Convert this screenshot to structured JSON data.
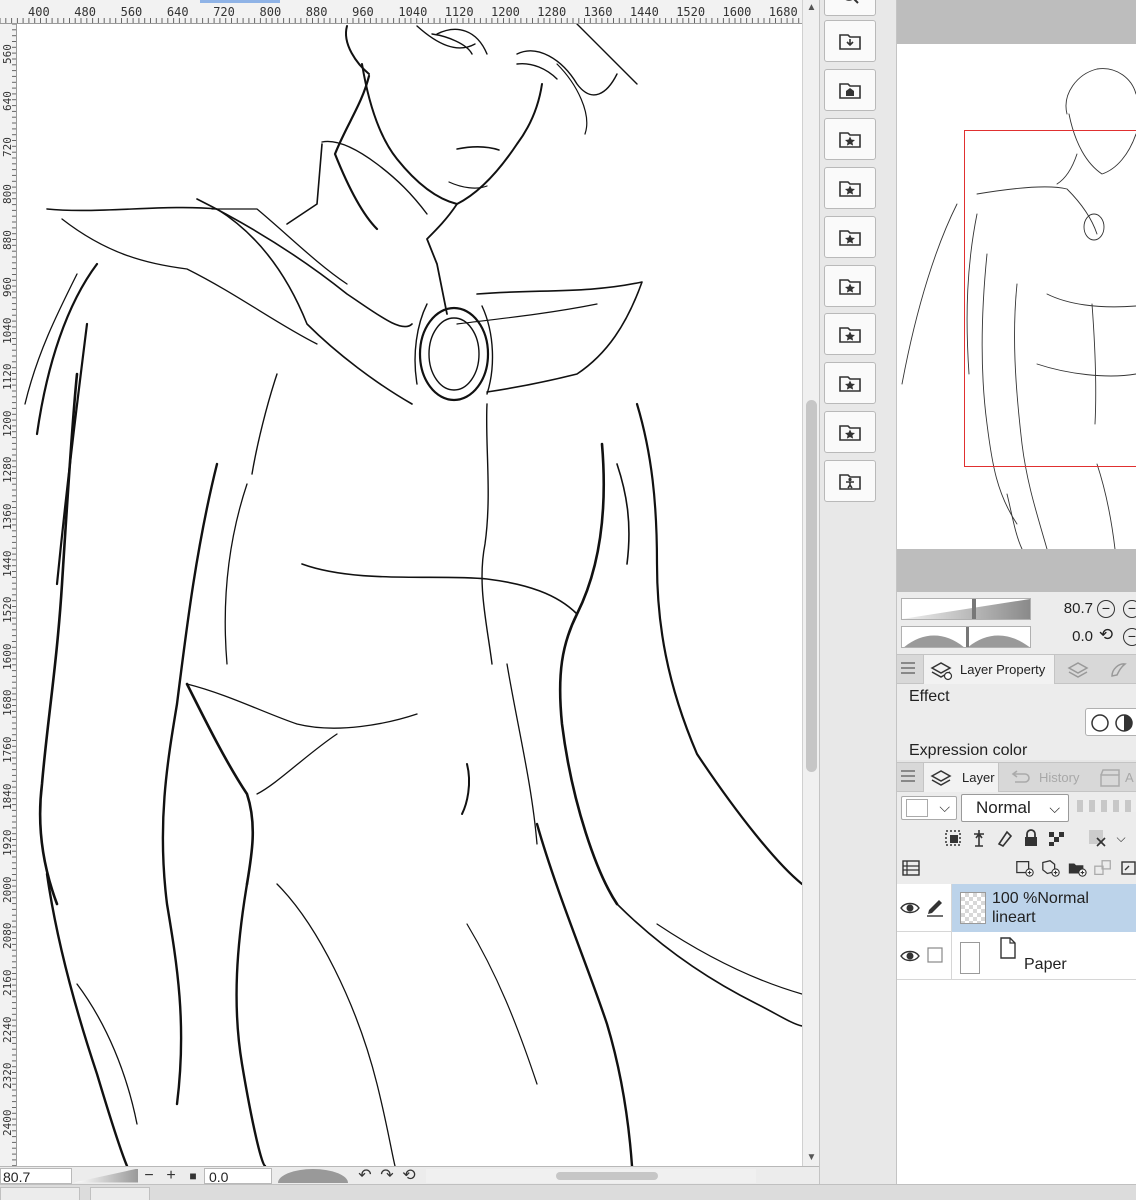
{
  "rulers": {
    "horizontal": [
      "400",
      "480",
      "560",
      "640",
      "720",
      "800",
      "880",
      "960",
      "1040",
      "1120",
      "1200",
      "1280",
      "1360",
      "1440",
      "1520",
      "1600",
      "1680"
    ],
    "vertical": [
      "560",
      "640",
      "720",
      "800",
      "880",
      "960",
      "1040",
      "1120",
      "1200",
      "1280",
      "1360",
      "1440",
      "1520",
      "1600",
      "1680",
      "1760",
      "1840",
      "1920",
      "2000",
      "2080",
      "2160",
      "2240",
      "2320",
      "2400"
    ]
  },
  "canvas_bar": {
    "zoom": "80.7",
    "minus": "−",
    "plus": "+",
    "stop": "■",
    "angle": "0.0",
    "rotate_left": "↶",
    "rotate_right": "↷",
    "reset": "⟲"
  },
  "material_palette": [
    "download-folder-icon",
    "home-folder-icon",
    "star-folder-icon",
    "star-folder-icon",
    "star-folder-icon",
    "star-folder-icon",
    "star-folder-icon",
    "star-folder-icon",
    "star-folder-icon",
    "figure-folder-icon"
  ],
  "navigator": {
    "zoom_value": "80.7",
    "rotation_value": "0.0",
    "frame_color": "#e03030"
  },
  "property_tabs": {
    "active": "Layer Property"
  },
  "layer_property": {
    "effect_label": "Effect",
    "expression_color_label": "Expression color"
  },
  "layer_tabs": {
    "layer": "Layer",
    "history": "History",
    "third": "A"
  },
  "layer_toolbar": {
    "blend_mode": "Normal"
  },
  "layers": [
    {
      "opacity": "100 %",
      "mode": "Normal",
      "name": "lineart",
      "selected": true
    },
    {
      "name": "Paper",
      "selected": false
    }
  ],
  "colors": {
    "accent": "#bcd3ea",
    "ruler_highlight": "#8fb3e6"
  }
}
